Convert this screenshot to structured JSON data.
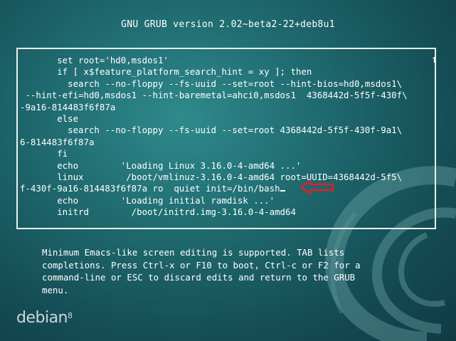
{
  "header": {
    "title": "GNU GRUB  version 2.02~beta2-22+deb8u1"
  },
  "editor": {
    "lines": [
      "       set root='hd0,msdos1'",
      "       if [ x$feature_platform_search_hint = xy ]; then",
      "         search --no-floppy --fs-uuid --set=root --hint-bios=hd0,msdos1\\",
      " --hint-efi=hd0,msdos1 --hint-baremetal=ahci0,msdos1  4368442d-5f5f-430f\\",
      "-9a16-814483f6f87a",
      "       else",
      "         search --no-floppy --fs-uuid --set=root 4368442d-5f5f-430f-9a1\\",
      "6-814483f6f87a",
      "       fi",
      "       echo        'Loading Linux 3.16.0-4-amd64 ...'",
      "       linux        /boot/vmlinuz-3.16.0-4-amd64 root=UUID=4368442d-5f5\\",
      "f-430f-9a16-814483f6f87a ro  quiet init=/bin/bash",
      "       echo        'Loading initial ramdisk ...'",
      "       initrd        /boot/initrd.img-3.16.0-4-amd64"
    ],
    "scroll_indicator": "↑"
  },
  "help_text": [
    "Minimum Emacs-like screen editing is supported. TAB lists",
    "completions. Press Ctrl-x or F10 to boot, Ctrl-c or F2 for a",
    "command-line or ESC to discard edits and return to the GRUB",
    "menu."
  ],
  "branding": {
    "name": "debian",
    "version": "8"
  },
  "colors": {
    "arrow": "#e0202a",
    "text": "#ffffff"
  }
}
